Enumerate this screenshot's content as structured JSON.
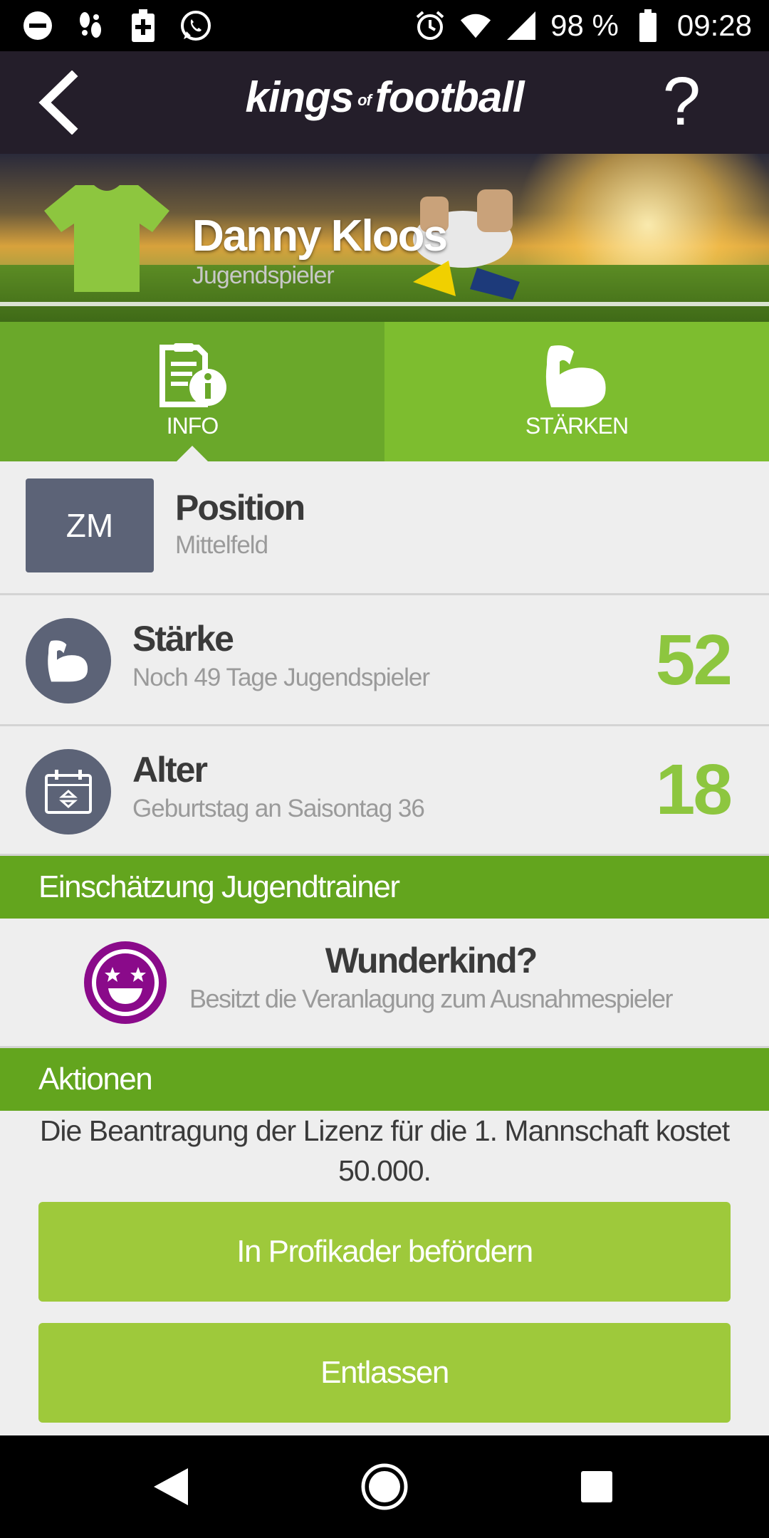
{
  "status_bar": {
    "battery": "98 %",
    "time": "09:28",
    "left_icons": [
      "minus-circle-icon",
      "steps-icon",
      "battery-plus-icon",
      "whatsapp-icon"
    ],
    "right_icons": [
      "alarm-icon",
      "wifi-icon",
      "signal-icon",
      "battery-icon"
    ]
  },
  "app_bar": {
    "logo_left": "kings",
    "logo_of": "of",
    "logo_right": "football",
    "help_label": "?"
  },
  "player": {
    "name": "Danny Kloos",
    "role": "Jugendspieler",
    "jersey_color": "#8dc63f"
  },
  "tabs": [
    {
      "label": "INFO",
      "icon": "info-document-icon",
      "active": true
    },
    {
      "label": "STÄRKEN",
      "icon": "muscle-icon",
      "active": false
    }
  ],
  "position": {
    "badge": "ZM",
    "title": "Position",
    "value": "Mittelfeld"
  },
  "strength": {
    "title": "Stärke",
    "subtitle": "Noch 49 Tage Jugendspieler",
    "value": "52"
  },
  "age": {
    "title": "Alter",
    "subtitle": "Geburtstag an Saisontag 36",
    "value": "18"
  },
  "assessment": {
    "section_title": "Einschätzung Jugendtrainer",
    "title": "Wunderkind?",
    "subtitle": "Besitzt die Veranlagung zum Ausnahmespieler",
    "icon_color": "#8a0a8a"
  },
  "actions": {
    "section_title": "Aktionen",
    "license_text": "Die Beantragung der Lizenz für die 1. Mannschaft kostet 50.000.",
    "promote_label": "In Profikader befördern",
    "dismiss_label": "Entlassen"
  },
  "colors": {
    "accent_green": "#8dc63f",
    "section_green": "#63a51e",
    "button_green": "#9ec93b",
    "badge_gray": "#5c6377"
  }
}
